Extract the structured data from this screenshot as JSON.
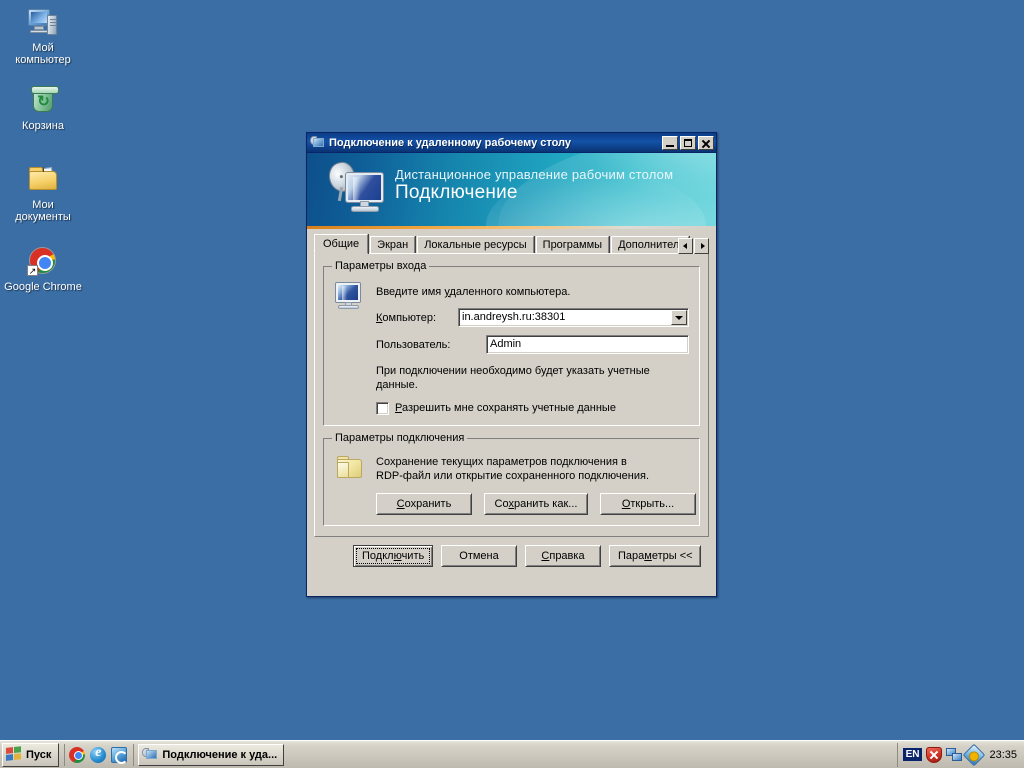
{
  "desktop": {
    "background_color": "#3a6ea5",
    "icons": [
      {
        "id": "my-computer",
        "label": "Мой\nкомпьютер",
        "line1": "Мой",
        "line2": "компьютер"
      },
      {
        "id": "recycle-bin",
        "label": "Корзина",
        "line1": "Корзина",
        "line2": ""
      },
      {
        "id": "my-documents",
        "label": "Мои\nдокументы",
        "line1": "Мои",
        "line2": "документы"
      },
      {
        "id": "google-chrome",
        "label": "Google Chrome",
        "line1": "Google Chrome",
        "line2": ""
      }
    ]
  },
  "window": {
    "title": "Подключение к удаленному рабочему столу",
    "titlebar_color": "#0b3c87",
    "buttons": {
      "minimize": "_",
      "maximize": "□",
      "close": "✕"
    },
    "banner": {
      "subtitle": "Дистанционное управление рабочим столом",
      "title": "Подключение",
      "accent_color": "#1fa3bf",
      "stripe_color": "#d87f1a"
    },
    "tabs": [
      {
        "id": "obshchie",
        "label": "Общие",
        "active": true
      },
      {
        "id": "ekran",
        "label": "Экран",
        "active": false
      },
      {
        "id": "lokalnye-resursy",
        "label": "Локальные ресурсы",
        "active": false
      },
      {
        "id": "programmy",
        "label": "Программы",
        "active": false
      },
      {
        "id": "dopolnitelno",
        "label": "Дополнительно",
        "active": false
      }
    ],
    "login_group": {
      "title": "Параметры входа",
      "hint": "Введите имя удаленного компьютера.",
      "computer_label": "Компьютер:",
      "computer_value": "in.andreysh.ru:38301",
      "user_label": "Пользователь:",
      "user_value": "Admin",
      "credentials_note_line1": "При подключении необходимо будет указать учетные",
      "credentials_note_line2": "данные.",
      "save_credentials_label": "Разрешить мне сохранять учетные данные",
      "save_credentials_checked": false
    },
    "connection_group": {
      "title": "Параметры подключения",
      "hint_line1": "Сохранение текущих параметров подключения в",
      "hint_line2": "RDP-файл или открытие сохраненного подключения.",
      "save_label": "Сохранить",
      "save_as_label": "Сохранить как...",
      "open_label": "Открыть..."
    },
    "actions": {
      "connect_label": "Подключить",
      "cancel_label": "Отмена",
      "help_label": "Справка",
      "options_label": "Параметры <<"
    }
  },
  "taskbar": {
    "start_label": "Пуск",
    "quick_launch": [
      {
        "id": "chrome",
        "name": "chrome-icon"
      },
      {
        "id": "internet-explorer",
        "name": "internet-explorer-icon"
      },
      {
        "id": "show-desktop",
        "name": "show-desktop-icon"
      }
    ],
    "items": [
      {
        "id": "rdp",
        "label": "Подключение к уда..."
      }
    ],
    "tray": {
      "language": "EN",
      "icons": [
        {
          "id": "security-alert",
          "name": "shield-alert-icon"
        },
        {
          "id": "network",
          "name": "network-icon"
        },
        {
          "id": "updates",
          "name": "updates-icon"
        }
      ],
      "clock": "23:35"
    }
  }
}
